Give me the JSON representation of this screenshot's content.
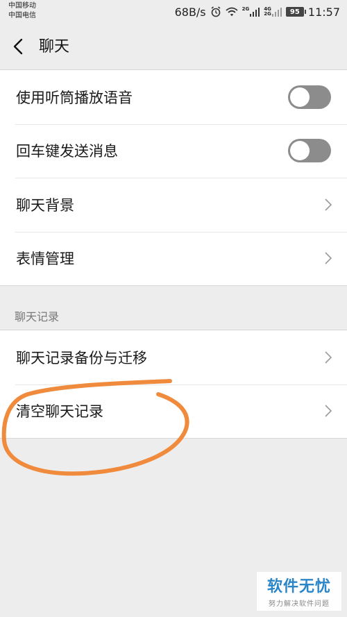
{
  "status_bar": {
    "carrier_1": "中国移动",
    "carrier_2": "中国电信",
    "net_speed": "68B/s",
    "signal_1_label": "2G",
    "signal_2_label_top": "4G",
    "signal_2_label_bottom": "2G",
    "battery": "95",
    "time": "11:57"
  },
  "header": {
    "title": "聊天"
  },
  "settings": {
    "items": [
      {
        "label": "使用听筒播放语音",
        "control": "toggle",
        "on": false
      },
      {
        "label": "回车键发送消息",
        "control": "toggle",
        "on": false
      },
      {
        "label": "聊天背景",
        "control": "chevron"
      },
      {
        "label": "表情管理",
        "control": "chevron"
      }
    ]
  },
  "chat_history": {
    "section_title": "聊天记录",
    "items": [
      {
        "label": "聊天记录备份与迁移",
        "control": "chevron"
      },
      {
        "label": "清空聊天记录",
        "control": "chevron"
      }
    ]
  },
  "annotation": {
    "color": "#f08a3c",
    "shape": "hand-drawn-circle"
  },
  "watermark": {
    "main": "软件无忧",
    "sub": "努力解决软件问题"
  },
  "colors": {
    "background": "#ededed",
    "card": "#ffffff",
    "toggle_off": "#8c8c8c",
    "section_text": "#777777",
    "watermark_blue": "#2a86c8"
  }
}
